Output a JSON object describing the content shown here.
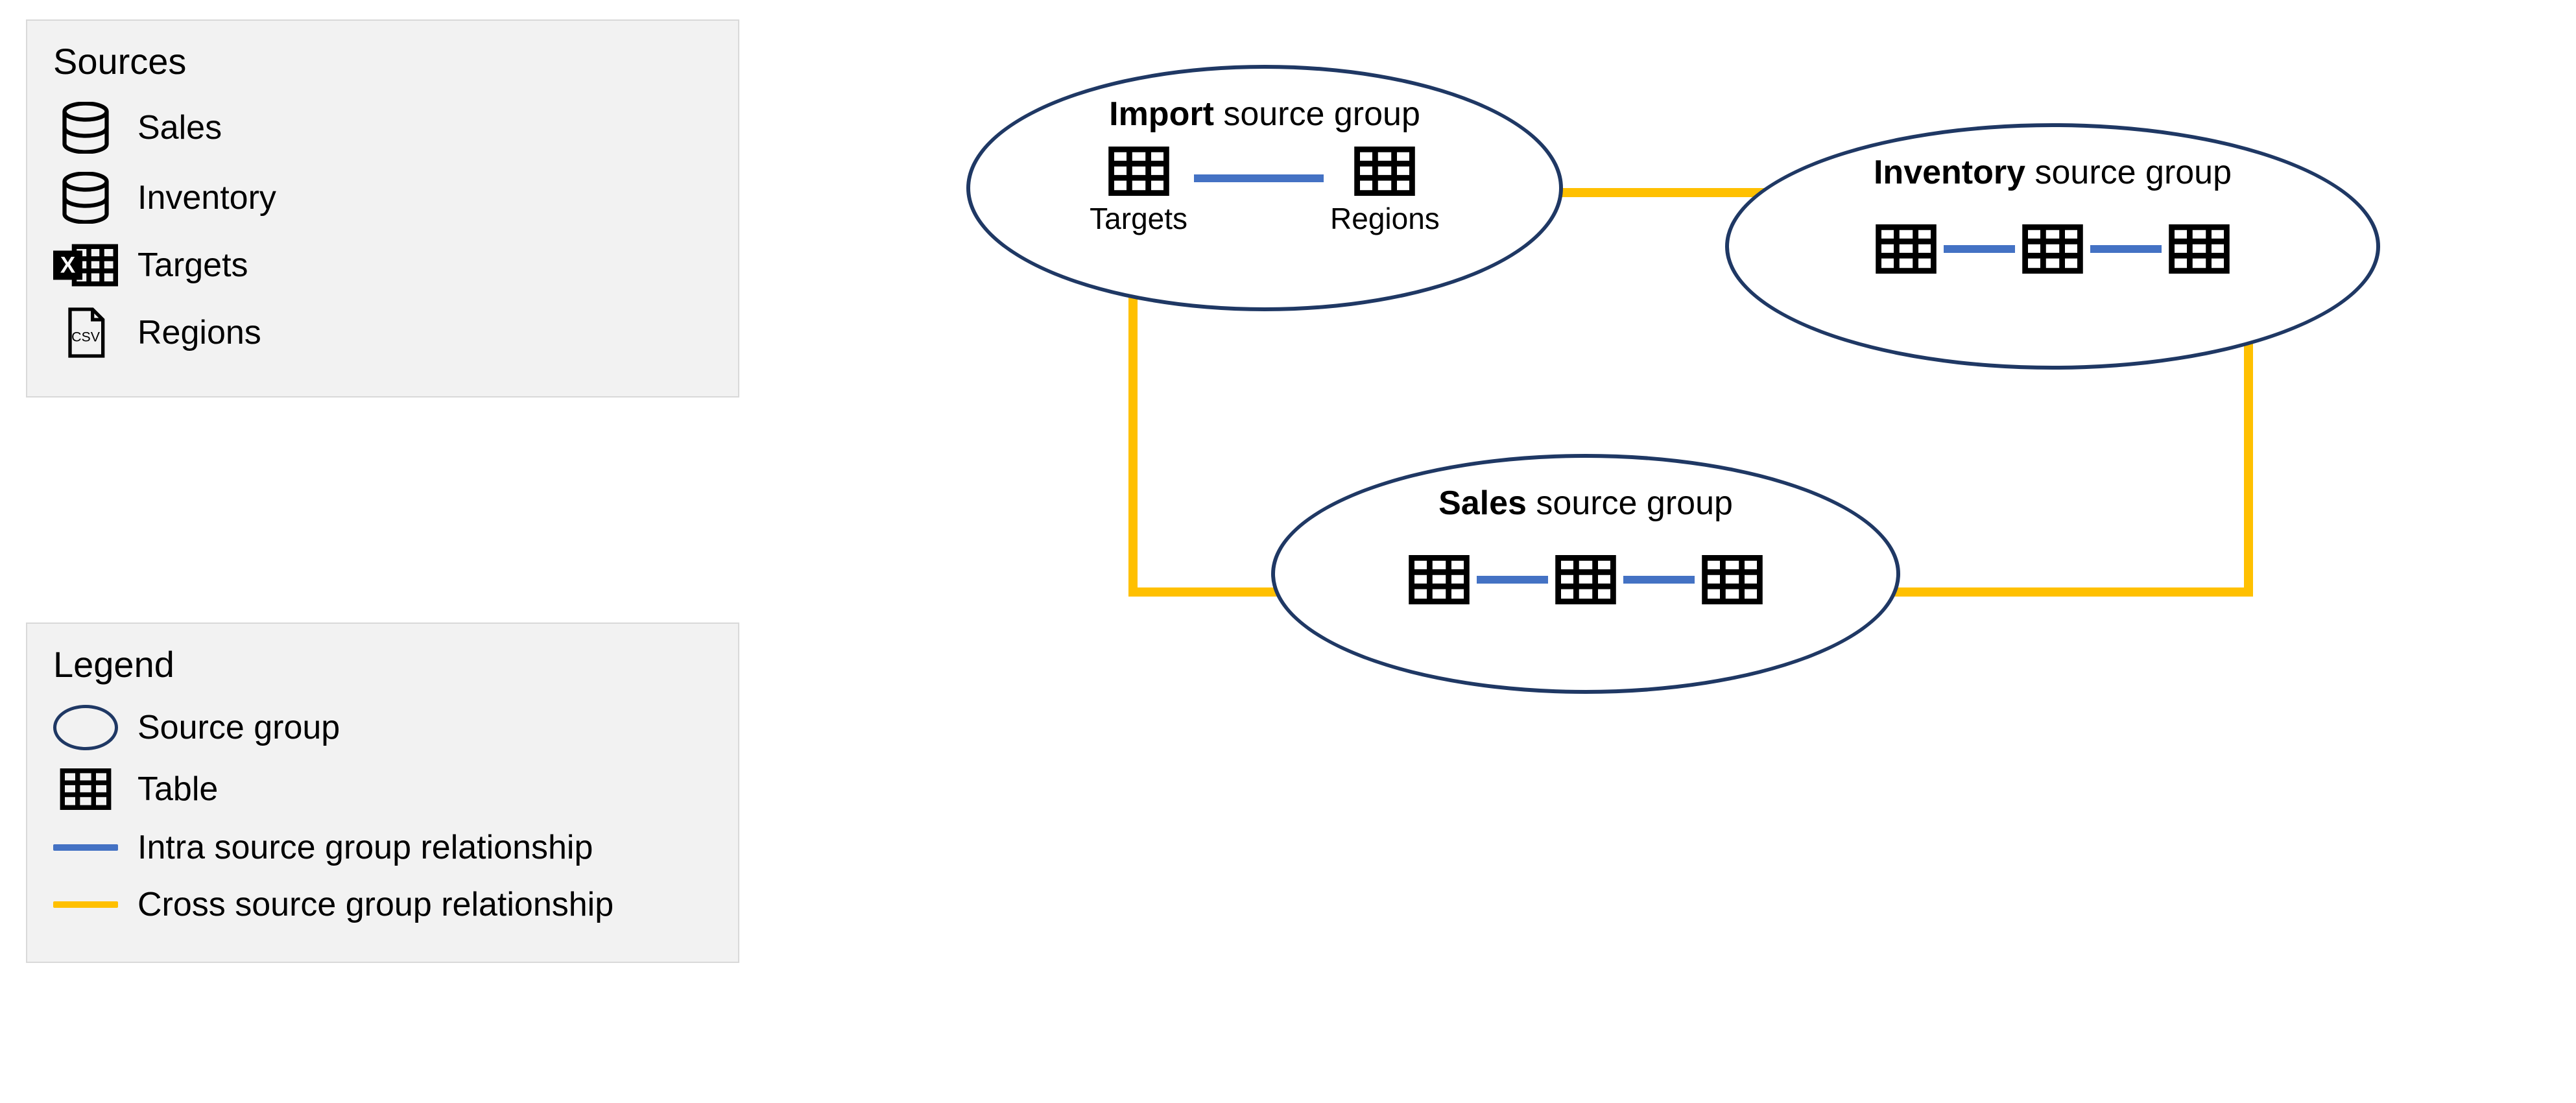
{
  "sourcesPanel": {
    "title": "Sources",
    "items": [
      {
        "label": "Sales",
        "icon": "database-icon"
      },
      {
        "label": "Inventory",
        "icon": "database-icon"
      },
      {
        "label": "Targets",
        "icon": "excel-icon"
      },
      {
        "label": "Regions",
        "icon": "csv-file-icon"
      }
    ]
  },
  "legendPanel": {
    "title": "Legend",
    "items": [
      {
        "kind": "ellipse",
        "label": "Source group"
      },
      {
        "kind": "table-icon",
        "label": "Table"
      },
      {
        "kind": "blue-line",
        "label": "Intra source group relationship"
      },
      {
        "kind": "orange-line",
        "label": "Cross source group relationship"
      }
    ]
  },
  "groups": {
    "import": {
      "titleBold": "Import",
      "titleRest": " source group",
      "tables": [
        {
          "caption": "Targets"
        },
        {
          "caption": "Regions"
        }
      ]
    },
    "inventory": {
      "titleBold": "Inventory",
      "titleRest": " source group",
      "tables": [
        {},
        {},
        {}
      ]
    },
    "sales": {
      "titleBold": "Sales",
      "titleRest": " source group",
      "tables": [
        {},
        {},
        {}
      ]
    }
  },
  "colors": {
    "groupBorder": "#1f3864",
    "intra": "#4472c4",
    "cross": "#ffc000",
    "panelBg": "#f2f2f2"
  }
}
